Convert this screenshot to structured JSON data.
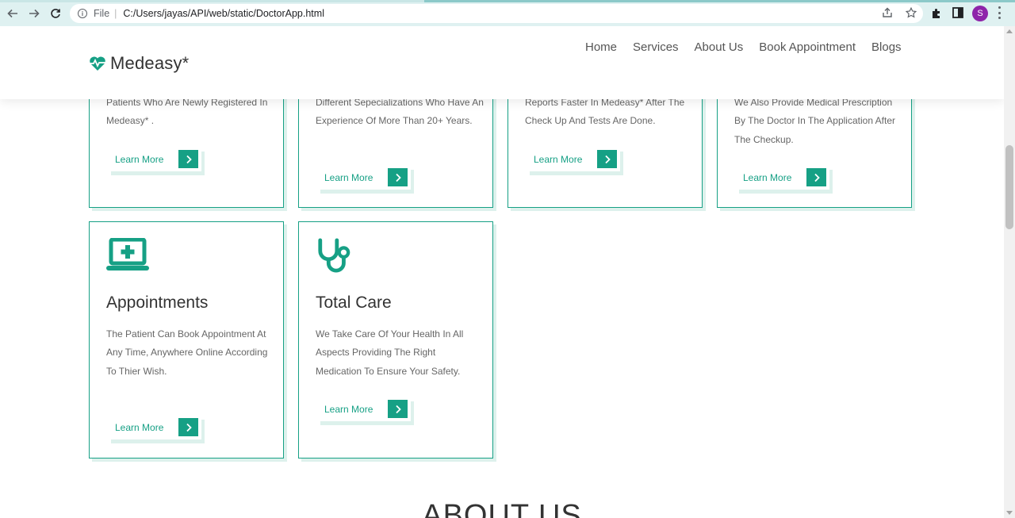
{
  "browser": {
    "url_scheme_label": "File",
    "url": "C:/Users/jayas/API/web/static/DoctorApp.html",
    "profile_initial": "S"
  },
  "header": {
    "brand": "Medeasy*",
    "nav": [
      "Home",
      "Services",
      "About Us",
      "Book Appointment",
      "Blogs"
    ]
  },
  "cards_top": [
    {
      "desc": "Patients Who Are Newly Registered In Medeasy* .",
      "button": "Learn More"
    },
    {
      "desc": "Different Sepecializations Who Have An Experience Of More Than 20+ Years.",
      "button": "Learn More"
    },
    {
      "desc": "Reports Faster In Medeasy* After The Check Up And Tests Are Done.",
      "button": "Learn More"
    },
    {
      "desc": "We Also Provide Medical Prescription By The Doctor In The Application After The Checkup.",
      "button": "Learn More"
    }
  ],
  "cards_bottom": [
    {
      "title": "Appointments",
      "desc": "The Patient Can Book Appointment At Any Time, Anywhere Online According To Thier Wish.",
      "button": "Learn More",
      "icon": "laptop-medical-icon"
    },
    {
      "title": "Total Care",
      "desc": "We Take Care Of Your Health In All Aspects Providing The Right Medication To Ensure Your Safety.",
      "button": "Learn More",
      "icon": "stethoscope-icon"
    }
  ],
  "about_heading": "ABOUT US",
  "colors": {
    "accent": "#16a085",
    "accent_light": "#ddf1ec",
    "chrome": "#dff1f1",
    "avatar": "#8e24aa"
  }
}
